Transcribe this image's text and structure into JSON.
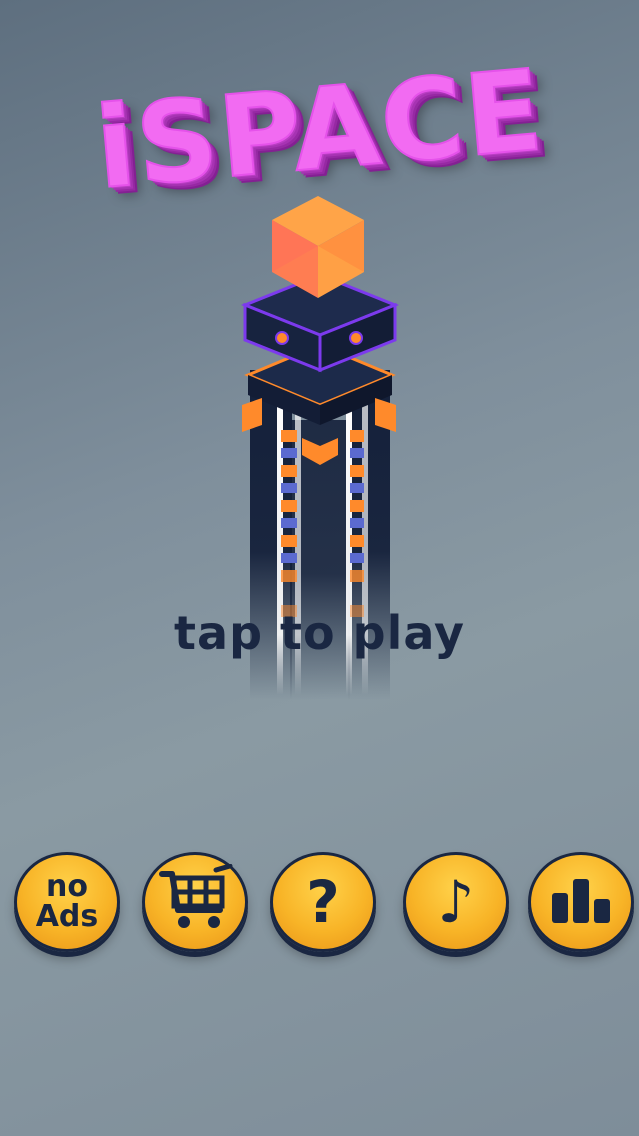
{
  "game": {
    "title": "iSPACE",
    "prompt": "tap to play"
  },
  "menu": {
    "no_ads": {
      "line1": "no",
      "line2": "Ads"
    },
    "shop": {
      "icon": "shopping-cart-icon"
    },
    "help": {
      "glyph": "?"
    },
    "music": {
      "glyph": "♪"
    },
    "leaderboard": {
      "icon": "bar-chart-icon"
    }
  },
  "colors": {
    "title": "#f26bf2",
    "button": "#f8b427",
    "dark": "#1a2742",
    "cube": "#ff8a3d",
    "tower_accent": "#7c3aed",
    "tower_orange": "#ff8a2b"
  }
}
